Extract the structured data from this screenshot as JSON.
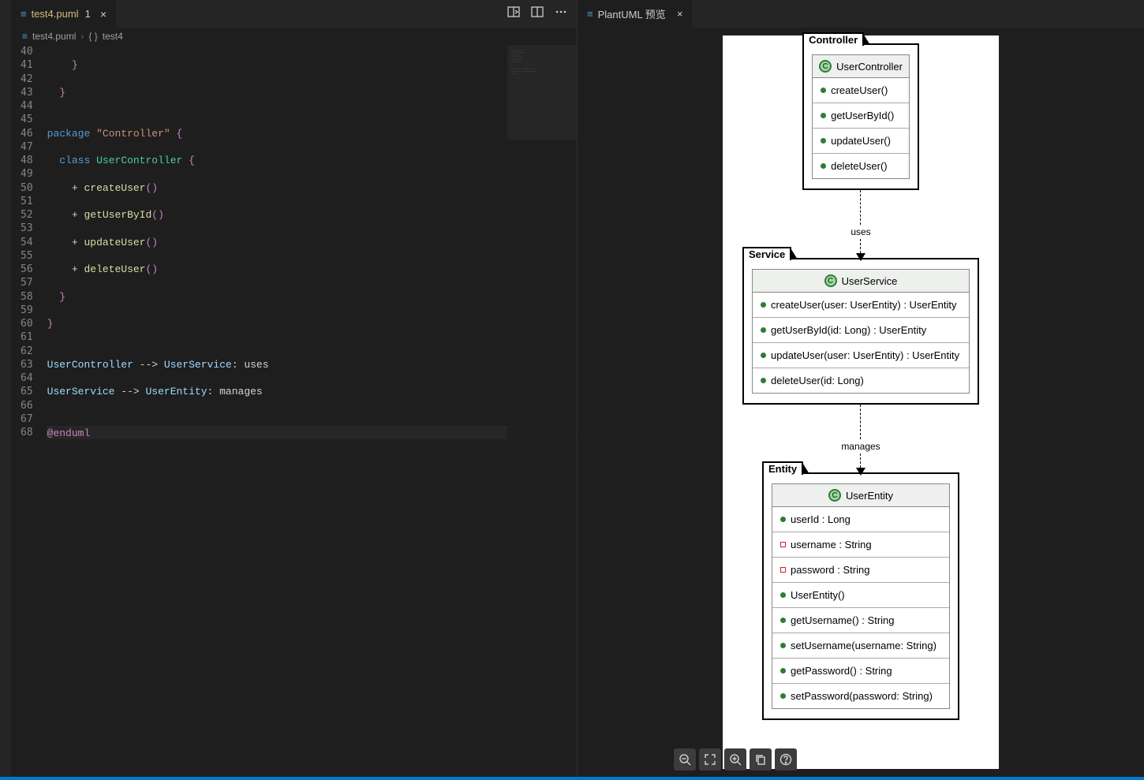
{
  "editor": {
    "tab_label": "test4.puml",
    "tab_modified": "1",
    "breadcrumb_file": "test4.puml",
    "breadcrumb_symbol": "test4",
    "line_start": 40,
    "line_end": 68,
    "code_lines": [
      {
        "n": 40,
        "segs": [
          {
            "t": "    ",
            "c": "pn"
          }
        ]
      },
      {
        "n": 41,
        "segs": [
          {
            "t": "    }",
            "c": "bn"
          }
        ]
      },
      {
        "n": 42,
        "segs": [
          {
            "t": " ",
            "c": "pn"
          }
        ]
      },
      {
        "n": 43,
        "segs": [
          {
            "t": "  }",
            "c": "bn"
          }
        ]
      },
      {
        "n": 44,
        "segs": [
          {
            "t": " ",
            "c": "pn"
          }
        ]
      },
      {
        "n": 45,
        "segs": [
          {
            "t": " ",
            "c": "pn"
          }
        ]
      },
      {
        "n": 46,
        "segs": [
          {
            "t": "package ",
            "c": "kw"
          },
          {
            "t": "\"Controller\"",
            "c": "str"
          },
          {
            "t": " {",
            "c": "bn"
          }
        ]
      },
      {
        "n": 47,
        "segs": [
          {
            "t": " ",
            "c": "pn"
          }
        ]
      },
      {
        "n": 48,
        "segs": [
          {
            "t": "  class ",
            "c": "kw"
          },
          {
            "t": "UserController",
            "c": "type"
          },
          {
            "t": " {",
            "c": "bn"
          }
        ]
      },
      {
        "n": 49,
        "segs": [
          {
            "t": " ",
            "c": "pn"
          }
        ]
      },
      {
        "n": 50,
        "segs": [
          {
            "t": "    + ",
            "c": "pn"
          },
          {
            "t": "createUser",
            "c": "fn"
          },
          {
            "t": "()",
            "c": "bn"
          }
        ]
      },
      {
        "n": 51,
        "segs": [
          {
            "t": " ",
            "c": "pn"
          }
        ]
      },
      {
        "n": 52,
        "segs": [
          {
            "t": "    + ",
            "c": "pn"
          },
          {
            "t": "getUserById",
            "c": "fn"
          },
          {
            "t": "()",
            "c": "bn"
          }
        ]
      },
      {
        "n": 53,
        "segs": [
          {
            "t": " ",
            "c": "pn"
          }
        ]
      },
      {
        "n": 54,
        "segs": [
          {
            "t": "    + ",
            "c": "pn"
          },
          {
            "t": "updateUser",
            "c": "fn"
          },
          {
            "t": "()",
            "c": "bn"
          }
        ]
      },
      {
        "n": 55,
        "segs": [
          {
            "t": " ",
            "c": "pn"
          }
        ]
      },
      {
        "n": 56,
        "segs": [
          {
            "t": "    + ",
            "c": "pn"
          },
          {
            "t": "deleteUser",
            "c": "fn"
          },
          {
            "t": "()",
            "c": "bn"
          }
        ]
      },
      {
        "n": 57,
        "segs": [
          {
            "t": " ",
            "c": "pn"
          }
        ]
      },
      {
        "n": 58,
        "segs": [
          {
            "t": "  }",
            "c": "bn"
          }
        ]
      },
      {
        "n": 59,
        "segs": [
          {
            "t": " ",
            "c": "pn"
          }
        ]
      },
      {
        "n": 60,
        "segs": [
          {
            "t": "}",
            "c": "bn"
          }
        ]
      },
      {
        "n": 61,
        "segs": [
          {
            "t": " ",
            "c": "pn"
          }
        ]
      },
      {
        "n": 62,
        "segs": [
          {
            "t": " ",
            "c": "pn"
          }
        ]
      },
      {
        "n": 63,
        "segs": [
          {
            "t": "UserController",
            "c": "ident"
          },
          {
            "t": " --> ",
            "c": "pn"
          },
          {
            "t": "UserService",
            "c": "ident"
          },
          {
            "t": ": uses",
            "c": "pn"
          }
        ]
      },
      {
        "n": 64,
        "segs": [
          {
            "t": " ",
            "c": "pn"
          }
        ]
      },
      {
        "n": 65,
        "segs": [
          {
            "t": "UserService",
            "c": "ident"
          },
          {
            "t": " --> ",
            "c": "pn"
          },
          {
            "t": "UserEntity",
            "c": "ident"
          },
          {
            "t": ": manages",
            "c": "pn"
          }
        ]
      },
      {
        "n": 66,
        "segs": [
          {
            "t": " ",
            "c": "pn"
          }
        ]
      },
      {
        "n": 67,
        "segs": [
          {
            "t": " ",
            "c": "pn"
          }
        ]
      },
      {
        "n": 68,
        "hl": true,
        "segs": [
          {
            "t": "@enduml",
            "c": "at"
          }
        ]
      }
    ]
  },
  "preview": {
    "tab_label": "PlantUML 预览",
    "packages": [
      {
        "name": "Controller",
        "class_name": "UserController",
        "class_letter": "C",
        "members": [
          {
            "vis": "public",
            "label": "createUser()"
          },
          {
            "vis": "public",
            "label": "getUserById()"
          },
          {
            "vis": "public",
            "label": "updateUser()"
          },
          {
            "vis": "public",
            "label": "deleteUser()"
          }
        ]
      },
      {
        "name": "Service",
        "class_name": "UserService",
        "class_letter": "C",
        "members": [
          {
            "vis": "public",
            "label": "createUser(user: UserEntity) : UserEntity"
          },
          {
            "vis": "public",
            "label": "getUserById(id: Long) : UserEntity"
          },
          {
            "vis": "public",
            "label": "updateUser(user: UserEntity) : UserEntity"
          },
          {
            "vis": "public",
            "label": "deleteUser(id: Long)"
          }
        ]
      },
      {
        "name": "Entity",
        "class_name": "UserEntity",
        "class_letter": "C",
        "attrs": [
          {
            "vis": "public",
            "label": "userId : Long"
          },
          {
            "vis": "private",
            "label": "username : String"
          },
          {
            "vis": "private",
            "label": "password : String"
          }
        ],
        "members": [
          {
            "vis": "public",
            "label": "UserEntity()"
          },
          {
            "vis": "public",
            "label": "getUsername() : String"
          },
          {
            "vis": "public",
            "label": "setUsername(username: String)"
          },
          {
            "vis": "public",
            "label": "getPassword() : String"
          },
          {
            "vis": "public",
            "label": "setPassword(password: String)"
          }
        ]
      }
    ],
    "arrows": [
      {
        "label": "uses"
      },
      {
        "label": "manages"
      }
    ]
  }
}
